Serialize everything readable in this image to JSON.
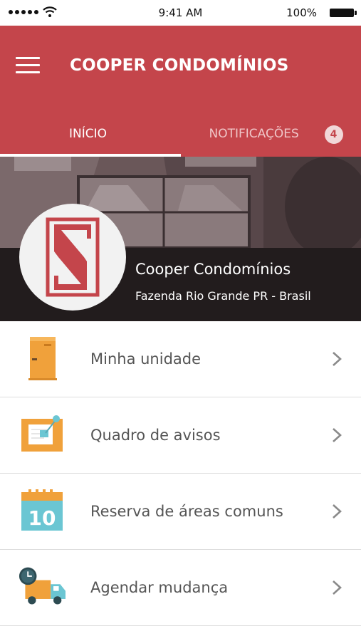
{
  "status_bar": {
    "time": "9:41 AM",
    "battery": "100%",
    "signal_icon": "signal-dots-icon",
    "wifi_icon": "wifi-icon",
    "battery_icon": "battery-icon"
  },
  "header": {
    "menu_icon": "hamburger-menu-icon",
    "title": "COOPER CONDOMÍNIOS",
    "color": "#c4454b"
  },
  "tabs": [
    {
      "label": "INÍCIO",
      "active": true
    },
    {
      "label": "NOTIFICAÇÕES",
      "active": false,
      "badge": "4"
    }
  ],
  "hero": {
    "logo_icon": "cooper-s-logo-icon",
    "name": "Cooper Condomínios",
    "location": "Fazenda Rio Grande PR - Brasil"
  },
  "menu_items": [
    {
      "label": "Minha unidade",
      "icon": "door-icon"
    },
    {
      "label": "Quadro de avisos",
      "icon": "notice-board-icon"
    },
    {
      "label": "Reserva de áreas comuns",
      "icon": "calendar-icon",
      "icon_text": "10"
    },
    {
      "label": "Agendar mudança",
      "icon": "moving-truck-icon"
    }
  ]
}
